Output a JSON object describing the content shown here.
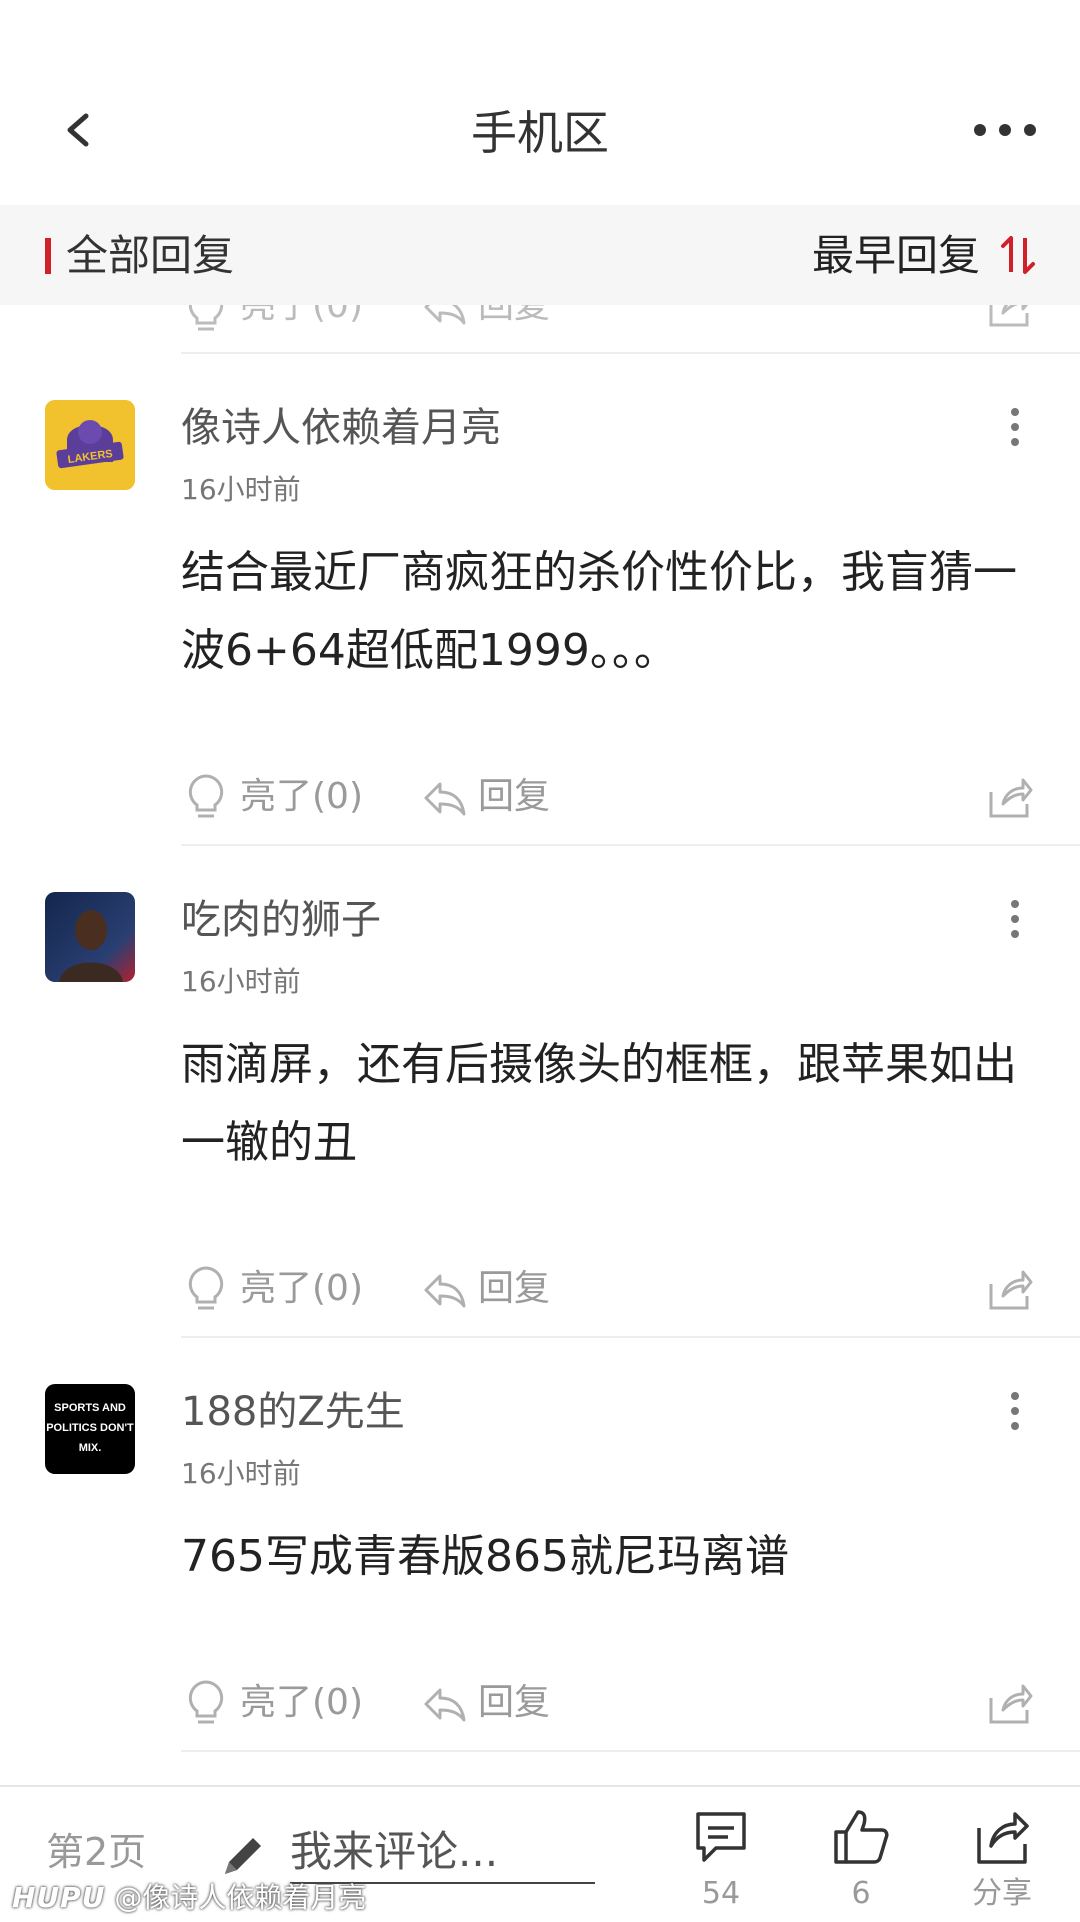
{
  "header": {
    "title": "手机区"
  },
  "sort_bar": {
    "label": "全部回复",
    "order_label": "最早回复"
  },
  "partial_row": {
    "like_label": "亮了(0)",
    "reply_label": "回复"
  },
  "comments": [
    {
      "author": "像诗人依赖着月亮",
      "time": "16小时前",
      "text": "结合最近厂商疯狂的杀价性价比，我盲猜一波6+64超低配1999。。。",
      "like_label": "亮了(0)",
      "reply_label": "回复",
      "avatar_text": "LAKERS",
      "avatar_color": "#f2c12e"
    },
    {
      "author": "吃肉的狮子",
      "time": "16小时前",
      "text": "雨滴屏，还有后摄像头的框框，跟苹果如出一辙的丑",
      "like_label": "亮了(0)",
      "reply_label": "回复",
      "avatar_color": "#1f3a6b"
    },
    {
      "author": "188的Z先生",
      "time": "16小时前",
      "text": "765写成青春版865就尼玛离谱",
      "like_label": "亮了(0)",
      "reply_label": "回复",
      "avatar_text_lines": [
        "SPORTS AND",
        "POLITICS DON'T",
        "MIX."
      ],
      "avatar_color": "#000000"
    }
  ],
  "bottom_bar": {
    "page_label": "第2页",
    "input_placeholder": "我来评论...",
    "comment_count": "54",
    "like_count": "6",
    "share_label": "分享"
  },
  "watermark": {
    "brand": "HUPU",
    "text": "@像诗人依赖着月亮"
  },
  "icons": {
    "back": "chevron-left-icon",
    "more": "more-horizontal-icon",
    "sort": "sort-toggle-icon",
    "like": "lightbulb-icon",
    "reply": "reply-arrow-icon",
    "share": "share-icon",
    "comment": "comment-bubble-icon",
    "thumb": "thumbs-up-icon",
    "pen": "pen-icon"
  },
  "colors": {
    "accent": "#d0202a",
    "muted": "#9a9a9a",
    "text": "#222222"
  }
}
